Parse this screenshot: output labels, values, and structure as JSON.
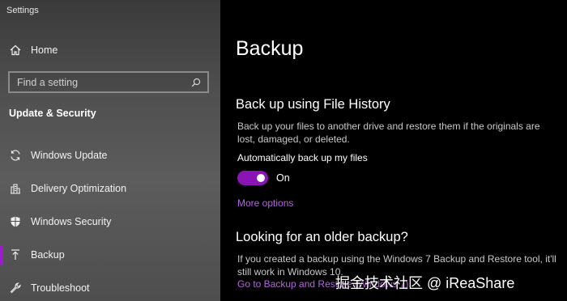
{
  "window": {
    "title": "Settings"
  },
  "sidebar": {
    "home_label": "Home",
    "search": {
      "placeholder": "Find a setting"
    },
    "section_title": "Update & Security",
    "items": [
      {
        "label": "Windows Update",
        "icon": "sync-icon"
      },
      {
        "label": "Delivery Optimization",
        "icon": "delivery-optimization-icon"
      },
      {
        "label": "Windows Security",
        "icon": "shield-icon"
      },
      {
        "label": "Backup",
        "icon": "upload-arrow-icon",
        "active": true
      },
      {
        "label": "Troubleshoot",
        "icon": "wrench-icon"
      }
    ]
  },
  "main": {
    "page_title": "Backup",
    "file_history": {
      "heading": "Back up using File History",
      "description": "Back up your files to another drive and restore them if the originals are lost, damaged, or deleted.",
      "auto_backup_label": "Automatically back up my files",
      "toggle_state": "On",
      "toggle_on": true,
      "more_options_link": "More options"
    },
    "older_backup": {
      "heading": "Looking for an older backup?",
      "description": "If you created a backup using the Windows 7 Backup and Restore tool, it'll still work in Windows 10.",
      "link": "Go to Backup and Restore (Windows 7)"
    }
  },
  "watermark": {
    "text": "掘金技术社区 @ iReaShare"
  },
  "colors": {
    "accent": "#8a14b4",
    "link": "#b463e3",
    "sidebar_bg": "#4f4f4f",
    "main_bg": "#000000"
  }
}
